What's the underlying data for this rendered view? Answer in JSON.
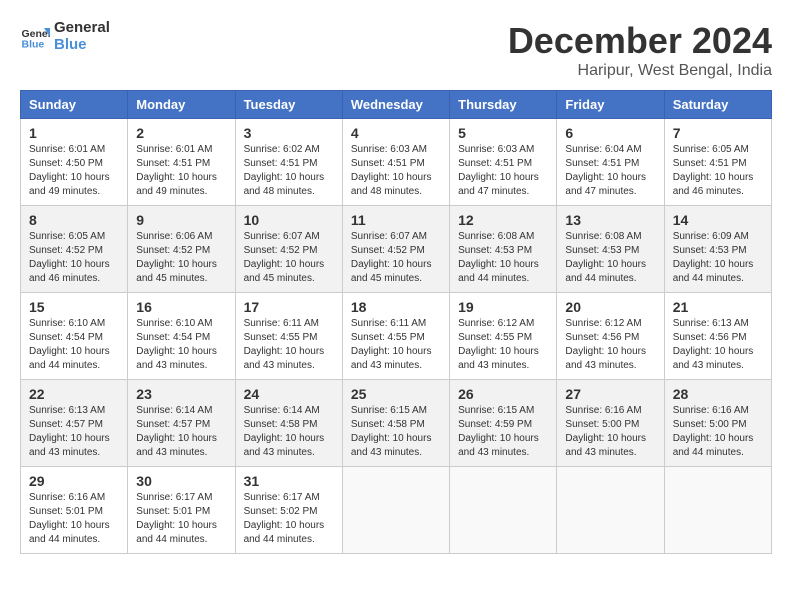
{
  "logo": {
    "line1": "General",
    "line2": "Blue"
  },
  "title": "December 2024",
  "subtitle": "Haripur, West Bengal, India",
  "days_of_week": [
    "Sunday",
    "Monday",
    "Tuesday",
    "Wednesday",
    "Thursday",
    "Friday",
    "Saturday"
  ],
  "weeks": [
    [
      {
        "day": "1",
        "sunrise": "6:01 AM",
        "sunset": "4:50 PM",
        "daylight": "10 hours and 49 minutes."
      },
      {
        "day": "2",
        "sunrise": "6:01 AM",
        "sunset": "4:51 PM",
        "daylight": "10 hours and 49 minutes."
      },
      {
        "day": "3",
        "sunrise": "6:02 AM",
        "sunset": "4:51 PM",
        "daylight": "10 hours and 48 minutes."
      },
      {
        "day": "4",
        "sunrise": "6:03 AM",
        "sunset": "4:51 PM",
        "daylight": "10 hours and 48 minutes."
      },
      {
        "day": "5",
        "sunrise": "6:03 AM",
        "sunset": "4:51 PM",
        "daylight": "10 hours and 47 minutes."
      },
      {
        "day": "6",
        "sunrise": "6:04 AM",
        "sunset": "4:51 PM",
        "daylight": "10 hours and 47 minutes."
      },
      {
        "day": "7",
        "sunrise": "6:05 AM",
        "sunset": "4:51 PM",
        "daylight": "10 hours and 46 minutes."
      }
    ],
    [
      {
        "day": "8",
        "sunrise": "6:05 AM",
        "sunset": "4:52 PM",
        "daylight": "10 hours and 46 minutes."
      },
      {
        "day": "9",
        "sunrise": "6:06 AM",
        "sunset": "4:52 PM",
        "daylight": "10 hours and 45 minutes."
      },
      {
        "day": "10",
        "sunrise": "6:07 AM",
        "sunset": "4:52 PM",
        "daylight": "10 hours and 45 minutes."
      },
      {
        "day": "11",
        "sunrise": "6:07 AM",
        "sunset": "4:52 PM",
        "daylight": "10 hours and 45 minutes."
      },
      {
        "day": "12",
        "sunrise": "6:08 AM",
        "sunset": "4:53 PM",
        "daylight": "10 hours and 44 minutes."
      },
      {
        "day": "13",
        "sunrise": "6:08 AM",
        "sunset": "4:53 PM",
        "daylight": "10 hours and 44 minutes."
      },
      {
        "day": "14",
        "sunrise": "6:09 AM",
        "sunset": "4:53 PM",
        "daylight": "10 hours and 44 minutes."
      }
    ],
    [
      {
        "day": "15",
        "sunrise": "6:10 AM",
        "sunset": "4:54 PM",
        "daylight": "10 hours and 44 minutes."
      },
      {
        "day": "16",
        "sunrise": "6:10 AM",
        "sunset": "4:54 PM",
        "daylight": "10 hours and 43 minutes."
      },
      {
        "day": "17",
        "sunrise": "6:11 AM",
        "sunset": "4:55 PM",
        "daylight": "10 hours and 43 minutes."
      },
      {
        "day": "18",
        "sunrise": "6:11 AM",
        "sunset": "4:55 PM",
        "daylight": "10 hours and 43 minutes."
      },
      {
        "day": "19",
        "sunrise": "6:12 AM",
        "sunset": "4:55 PM",
        "daylight": "10 hours and 43 minutes."
      },
      {
        "day": "20",
        "sunrise": "6:12 AM",
        "sunset": "4:56 PM",
        "daylight": "10 hours and 43 minutes."
      },
      {
        "day": "21",
        "sunrise": "6:13 AM",
        "sunset": "4:56 PM",
        "daylight": "10 hours and 43 minutes."
      }
    ],
    [
      {
        "day": "22",
        "sunrise": "6:13 AM",
        "sunset": "4:57 PM",
        "daylight": "10 hours and 43 minutes."
      },
      {
        "day": "23",
        "sunrise": "6:14 AM",
        "sunset": "4:57 PM",
        "daylight": "10 hours and 43 minutes."
      },
      {
        "day": "24",
        "sunrise": "6:14 AM",
        "sunset": "4:58 PM",
        "daylight": "10 hours and 43 minutes."
      },
      {
        "day": "25",
        "sunrise": "6:15 AM",
        "sunset": "4:58 PM",
        "daylight": "10 hours and 43 minutes."
      },
      {
        "day": "26",
        "sunrise": "6:15 AM",
        "sunset": "4:59 PM",
        "daylight": "10 hours and 43 minutes."
      },
      {
        "day": "27",
        "sunrise": "6:16 AM",
        "sunset": "5:00 PM",
        "daylight": "10 hours and 43 minutes."
      },
      {
        "day": "28",
        "sunrise": "6:16 AM",
        "sunset": "5:00 PM",
        "daylight": "10 hours and 44 minutes."
      }
    ],
    [
      {
        "day": "29",
        "sunrise": "6:16 AM",
        "sunset": "5:01 PM",
        "daylight": "10 hours and 44 minutes."
      },
      {
        "day": "30",
        "sunrise": "6:17 AM",
        "sunset": "5:01 PM",
        "daylight": "10 hours and 44 minutes."
      },
      {
        "day": "31",
        "sunrise": "6:17 AM",
        "sunset": "5:02 PM",
        "daylight": "10 hours and 44 minutes."
      },
      null,
      null,
      null,
      null
    ]
  ]
}
